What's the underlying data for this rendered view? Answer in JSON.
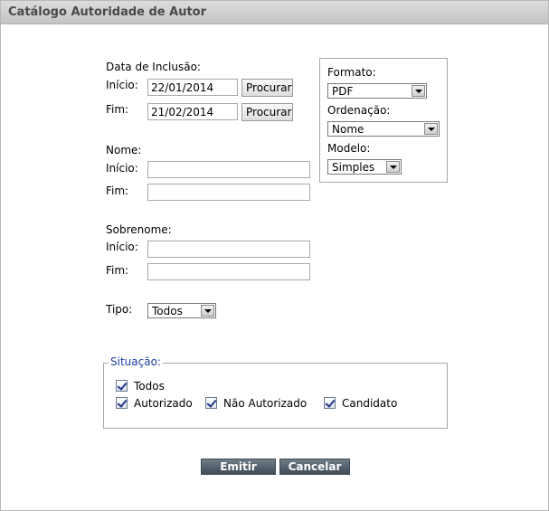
{
  "window": {
    "title": "Catálogo Autoridade de Autor"
  },
  "data_inclusao": {
    "label": "Data de Inclusão:",
    "inicio_label": "Início:",
    "inicio_value": "22/01/2014",
    "fim_label": "Fim:",
    "fim_value": "21/02/2014",
    "procurar_label": "Procurar"
  },
  "nome": {
    "label": "Nome:",
    "inicio_label": "Início:",
    "fim_label": "Fim:",
    "inicio_value": "",
    "fim_value": ""
  },
  "sobrenome": {
    "label": "Sobrenome:",
    "inicio_label": "Início:",
    "fim_label": "Fim:",
    "inicio_value": "",
    "fim_value": ""
  },
  "tipo": {
    "label": "Tipo:",
    "value": "Todos"
  },
  "options_panel": {
    "formato_label": "Formato:",
    "formato_value": "PDF",
    "ordenacao_label": "Ordenação:",
    "ordenacao_value": "Nome",
    "modelo_label": "Modelo:",
    "modelo_value": "Simples"
  },
  "situacao": {
    "legend": "Situação:",
    "todos": "Todos",
    "autorizado": "Autorizado",
    "nao_autorizado": "Não Autorizado",
    "candidato": "Candidato"
  },
  "actions": {
    "emitir": "Emitir",
    "cancelar": "Cancelar"
  },
  "colors": {
    "legend": "#1a3ea6",
    "button_dark": "#4f5b66",
    "title_text": "#4a4a4a"
  }
}
